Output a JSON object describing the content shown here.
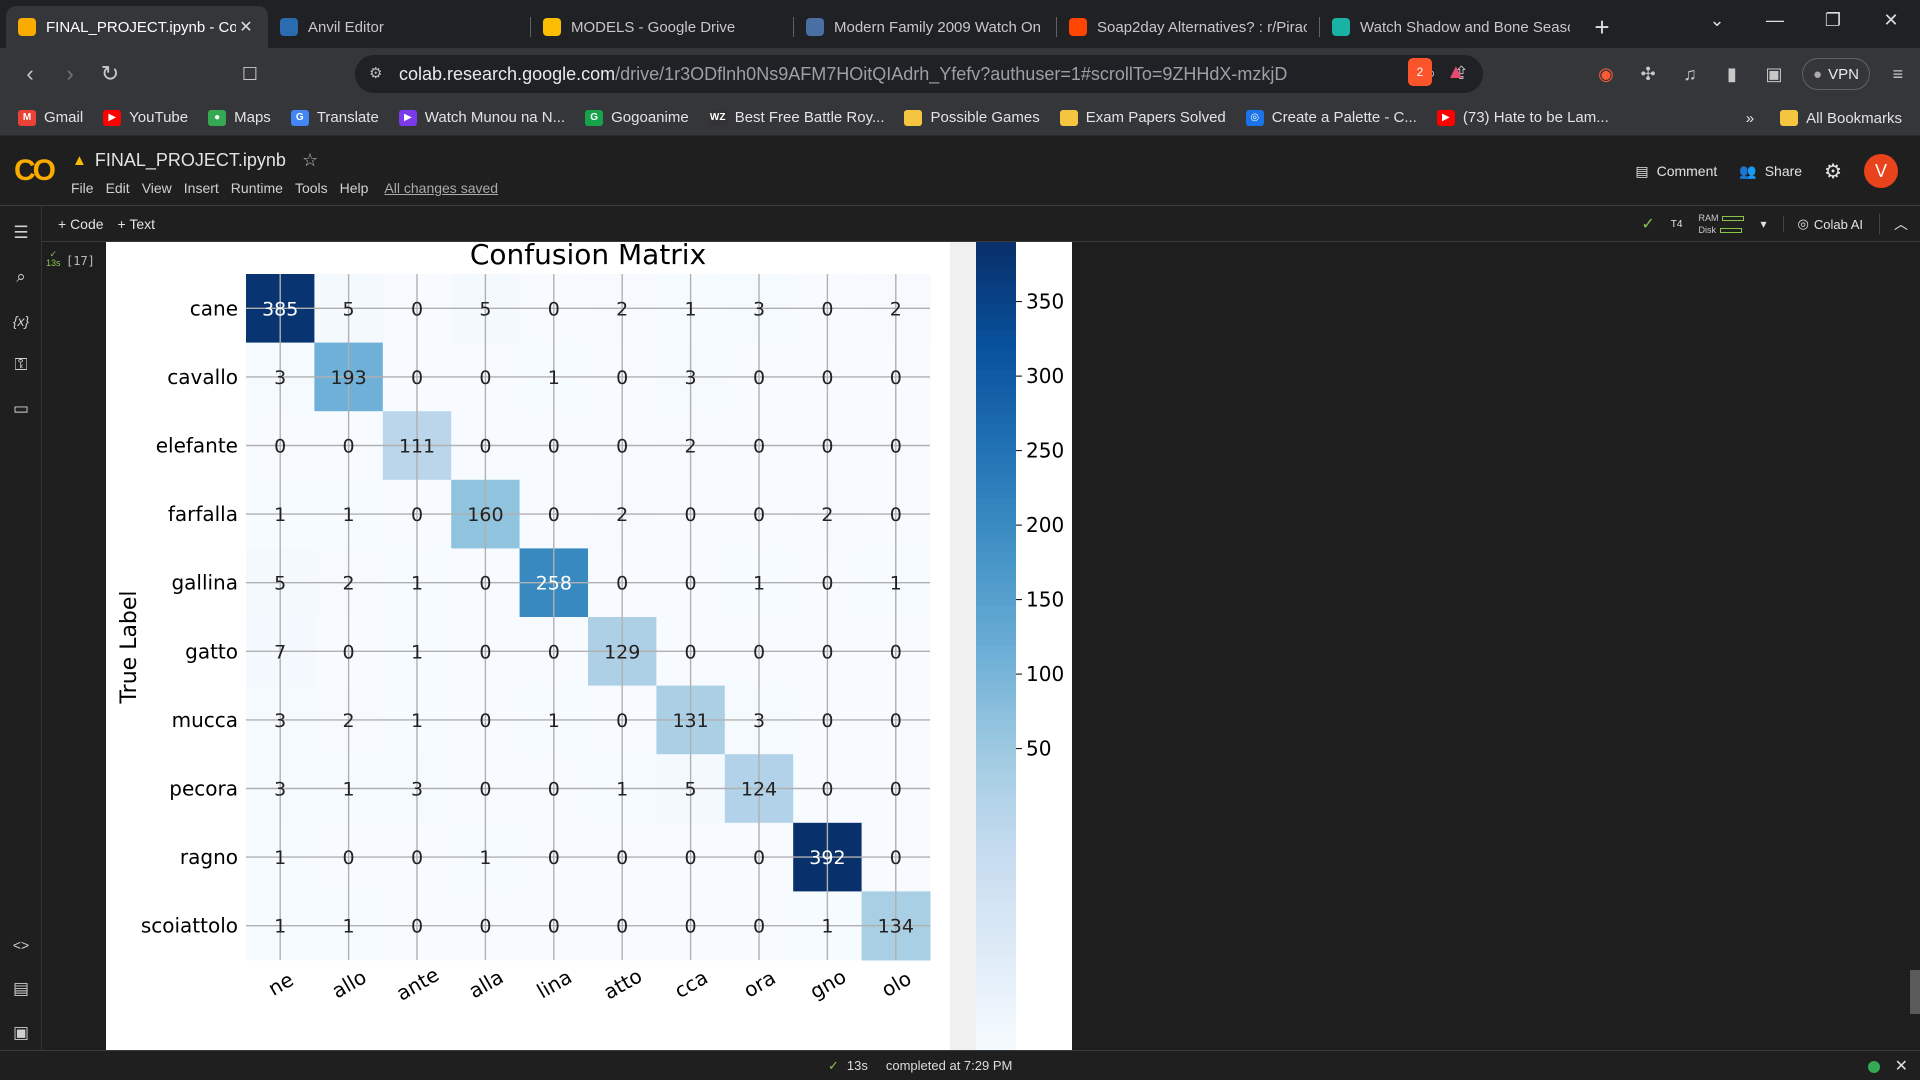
{
  "browser": {
    "tabs": [
      {
        "title": "FINAL_PROJECT.ipynb - Col",
        "icon": "colab-icon",
        "color": "#f9ab00",
        "active": true
      },
      {
        "title": "Anvil Editor",
        "icon": "anvil-icon",
        "color": "#2b6cb0",
        "active": false
      },
      {
        "title": "MODELS - Google Drive",
        "icon": "drive-icon",
        "color": "#fbbc04",
        "active": false
      },
      {
        "title": "Modern Family 2009 Watch On",
        "icon": "video-icon",
        "color": "#4a6fa5",
        "active": false
      },
      {
        "title": "Soap2day Alternatives? : r/Pirac",
        "icon": "reddit-icon",
        "color": "#ff4500",
        "active": false
      },
      {
        "title": "Watch Shadow and Bone Seaso",
        "icon": "stream-icon",
        "color": "#19b3a6",
        "active": false
      }
    ],
    "new_tab": "+",
    "url_host": "colab.research.google.com",
    "url_path": "/drive/1r3ODflnh0Ns9AFM7HOitQIAdrh_Yfefv?authuser=1#scrollTo=9ZHHdX-mzkjD",
    "vpn_label": "VPN",
    "brave_badge": "2",
    "bookmarks": [
      {
        "label": "Gmail",
        "color": "#ea4335",
        "icon": "gmail-icon",
        "glyph": "M"
      },
      {
        "label": "YouTube",
        "color": "#ff0000",
        "icon": "youtube-icon",
        "glyph": "▶"
      },
      {
        "label": "Maps",
        "color": "#34a853",
        "icon": "maps-icon",
        "glyph": "●"
      },
      {
        "label": "Translate",
        "color": "#4285f4",
        "icon": "translate-icon",
        "glyph": "G"
      },
      {
        "label": "Watch Munou na N...",
        "color": "#7c3aed",
        "icon": "play-icon",
        "glyph": "▶"
      },
      {
        "label": "Gogoanime",
        "color": "#16a34a",
        "icon": "gogo-icon",
        "glyph": "G"
      },
      {
        "label": "Best Free Battle Roy...",
        "color": "#333333",
        "icon": "wz-icon",
        "glyph": "WZ"
      },
      {
        "label": "Possible Games",
        "color": "#f5c542",
        "icon": "folder-icon",
        "glyph": ""
      },
      {
        "label": "Exam Papers Solved",
        "color": "#f5c542",
        "icon": "folder-icon",
        "glyph": ""
      },
      {
        "label": "Create a Palette - C...",
        "color": "#1a73e8",
        "icon": "palette-icon",
        "glyph": "◎"
      },
      {
        "label": "(73) Hate to be Lam...",
        "color": "#ff0000",
        "icon": "youtube-icon",
        "glyph": "▶"
      }
    ],
    "more_bookmarks": "»",
    "all_bookmarks": "All Bookmarks"
  },
  "colab": {
    "logo": "CO",
    "notebook_title": "FINAL_PROJECT.ipynb",
    "menu": [
      "File",
      "Edit",
      "View",
      "Insert",
      "Runtime",
      "Tools",
      "Help"
    ],
    "save_status": "All changes saved",
    "comment_label": "Comment",
    "share_label": "Share",
    "avatar_letter": "V",
    "add_code": "+ Code",
    "add_text": "+ Text",
    "runtime_type": "T4",
    "ram_label": "RAM",
    "disk_label": "Disk",
    "colab_ai_label": "Colab AI",
    "cell_exec_count": "[17]",
    "cell_run_time": "13s"
  },
  "status": {
    "run_time": "13s",
    "completed": "completed at 7:29 PM"
  },
  "chart_data": {
    "type": "heatmap",
    "title": "Confusion Matrix",
    "ylabel": "True Label",
    "labels": [
      "cane",
      "cavallo",
      "elefante",
      "farfalla",
      "gallina",
      "gatto",
      "mucca",
      "pecora",
      "ragno",
      "scoiattolo"
    ],
    "x_tick_fragments": [
      "ne",
      "allo",
      "ante",
      "alla",
      "lina",
      "atto",
      "cca",
      "ora",
      "gno",
      "olo"
    ],
    "matrix": [
      [
        385,
        5,
        0,
        5,
        0,
        2,
        1,
        3,
        0,
        2
      ],
      [
        3,
        193,
        0,
        0,
        1,
        0,
        3,
        0,
        0,
        0
      ],
      [
        0,
        0,
        111,
        0,
        0,
        0,
        2,
        0,
        0,
        0
      ],
      [
        1,
        1,
        0,
        160,
        0,
        2,
        0,
        0,
        2,
        0
      ],
      [
        5,
        2,
        1,
        0,
        258,
        0,
        0,
        1,
        0,
        1
      ],
      [
        7,
        0,
        1,
        0,
        0,
        129,
        0,
        0,
        0,
        0
      ],
      [
        3,
        2,
        1,
        0,
        1,
        0,
        131,
        3,
        0,
        0
      ],
      [
        3,
        1,
        3,
        0,
        0,
        1,
        5,
        124,
        0,
        0
      ],
      [
        1,
        0,
        0,
        1,
        0,
        0,
        0,
        0,
        392,
        0
      ],
      [
        1,
        1,
        0,
        0,
        0,
        0,
        0,
        0,
        1,
        134
      ]
    ],
    "colormap": "Blues",
    "vmin": 0,
    "vmax": 392,
    "colorbar_ticks": [
      50,
      100,
      150,
      200,
      250,
      300,
      350
    ],
    "grid": true
  }
}
